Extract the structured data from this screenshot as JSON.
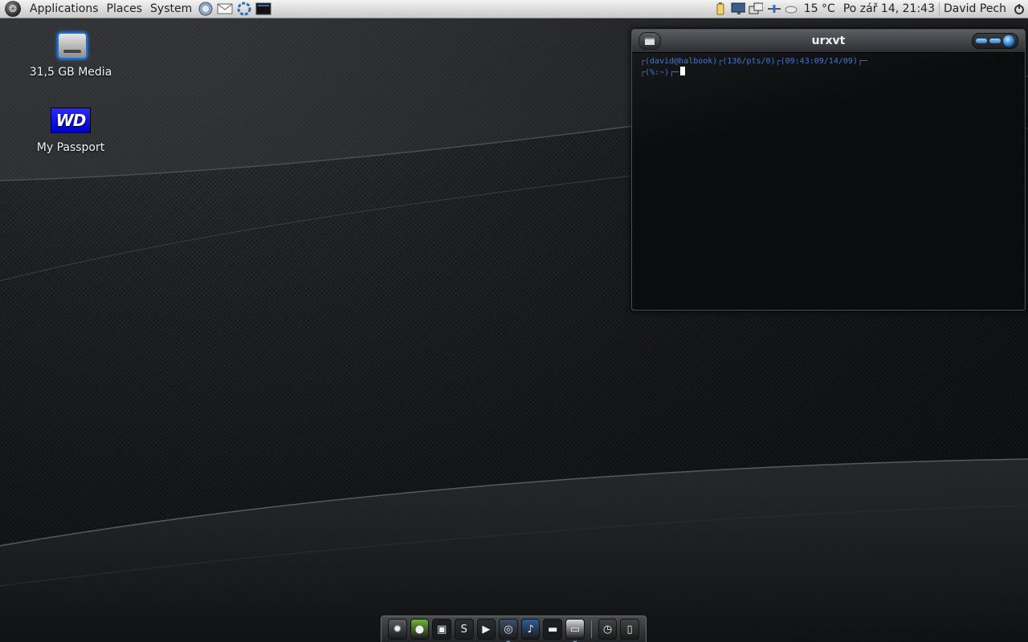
{
  "top_panel": {
    "menus": [
      "Applications",
      "Places",
      "System"
    ],
    "launchers": [
      "firefox-icon",
      "mail-icon",
      "pidgin-icon",
      "terminal-icon"
    ],
    "tray_icons": [
      "battery-icon",
      "display-icon",
      "network-icon",
      "transfer-icon",
      "weather-icon"
    ],
    "weather": "15 °C",
    "clock": "Po zář 14, 21:43",
    "user": "David Pech"
  },
  "desktop": {
    "icons": [
      {
        "label": "31,5 GB Media",
        "icon": "drive-icon"
      },
      {
        "label": "My Passport",
        "icon": "wd-passport-icon",
        "logo_text": "WD"
      }
    ]
  },
  "terminal": {
    "title": "urxvt",
    "lines": [
      "┌(david@halbook)┌(136/pts/0)┌(09:43:09/14/09)┌─",
      "┌(%:~)┌─"
    ]
  },
  "dock": {
    "items": [
      {
        "name": "system-settings",
        "glyph": "✹",
        "active": false
      },
      {
        "name": "user-account",
        "glyph": "●",
        "active": false
      },
      {
        "name": "terminal",
        "glyph": "▣",
        "active": false
      },
      {
        "name": "skype",
        "glyph": "S",
        "active": false
      },
      {
        "name": "media-player",
        "glyph": "▶",
        "active": false
      },
      {
        "name": "browser",
        "glyph": "◎",
        "active": true
      },
      {
        "name": "music-player",
        "glyph": "♪",
        "active": false
      },
      {
        "name": "window",
        "glyph": "▬",
        "active": false
      },
      {
        "name": "urxvt-window",
        "glyph": "▭",
        "active": true
      }
    ],
    "after_separator": [
      {
        "name": "clock",
        "glyph": "◷",
        "active": false
      },
      {
        "name": "trash",
        "glyph": "▯",
        "active": false
      }
    ]
  }
}
